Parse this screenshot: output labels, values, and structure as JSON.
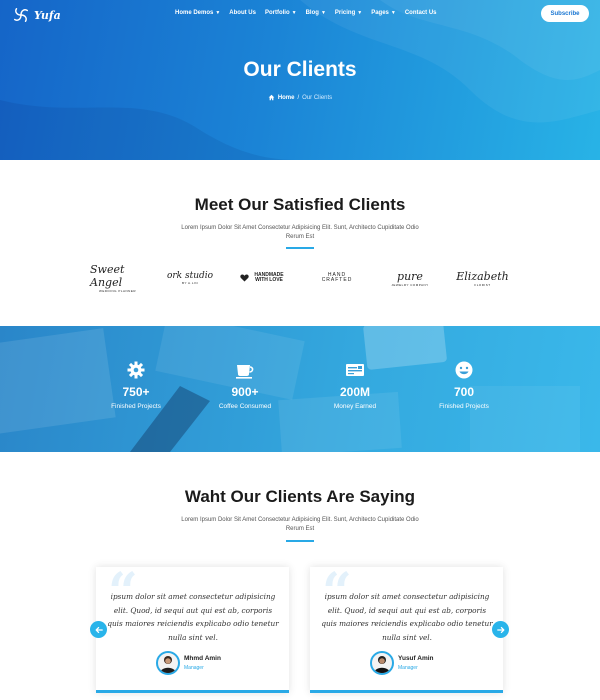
{
  "brand": {
    "name": "Yufa"
  },
  "nav": {
    "items": [
      {
        "label": "Home Demos",
        "dropdown": true
      },
      {
        "label": "About Us",
        "dropdown": false
      },
      {
        "label": "Portfolio",
        "dropdown": true
      },
      {
        "label": "Blog",
        "dropdown": true
      },
      {
        "label": "Pricing",
        "dropdown": true
      },
      {
        "label": "Pages",
        "dropdown": true
      },
      {
        "label": "Contact Us",
        "dropdown": false
      }
    ],
    "subscribe_label": "Subscribe"
  },
  "hero": {
    "title": "Our Clients",
    "breadcrumb": {
      "home": "Home",
      "separator": "/",
      "current": "Our Clients"
    }
  },
  "clients": {
    "title": "Meet Our Satisfied Clients",
    "description": "Lorem Ipsum Dolor Sit Amet Consectetur Adipisicing Elit. Sunt, Architecto Cupiditate Odio Rerum Est",
    "logos": [
      {
        "name": "Sweet Angel",
        "sub": "WEDDING PLANNER"
      },
      {
        "name": "ork studio",
        "sub": "BY A.LIN"
      },
      {
        "name": "HANDMADE WITH LOVE",
        "sub": ""
      },
      {
        "name": "HAND CRAFTED",
        "sub": ""
      },
      {
        "name": "pure",
        "sub": "JEWELRY COMPANY"
      },
      {
        "name": "Elizabeth",
        "sub": "FLORIST"
      }
    ]
  },
  "counters": [
    {
      "icon": "gear-icon",
      "value": "750+",
      "label": "Finished Projects"
    },
    {
      "icon": "coffee-icon",
      "value": "900+",
      "label": "Coffee Consumed"
    },
    {
      "icon": "money-icon",
      "value": "200M",
      "label": "Money Earned"
    },
    {
      "icon": "smile-icon",
      "value": "700",
      "label": "Finished Projects"
    }
  ],
  "testimonials": {
    "title": "Waht Our Clients Are Saying",
    "description": "Lorem Ipsum Dolor Sit Amet Consectetur Adipisicing Elit. Sunt, Architecto Cupiditate Odio Rerum Est",
    "items": [
      {
        "text": "ipsum dolor sit amet consectetur adipisicing elit. Quod, id sequi aut qui est ab, corporis quis maiores reiciendis explicabo odio tenetur nulla sint vel.",
        "name": "Mhmd Amin",
        "role": "Manager"
      },
      {
        "text": "ipsum dolor sit amet consectetur adipisicing elit. Quod, id sequi aut qui est ab, corporis quis maiores reiciendis explicabo odio tenetur nulla sint vel.",
        "name": "Yusuf Amin",
        "role": "Manager"
      }
    ]
  },
  "colors": {
    "accent": "#29a9e6",
    "hero_start": "#1565c8",
    "hero_end": "#28b3e6",
    "white": "#ffffff"
  }
}
